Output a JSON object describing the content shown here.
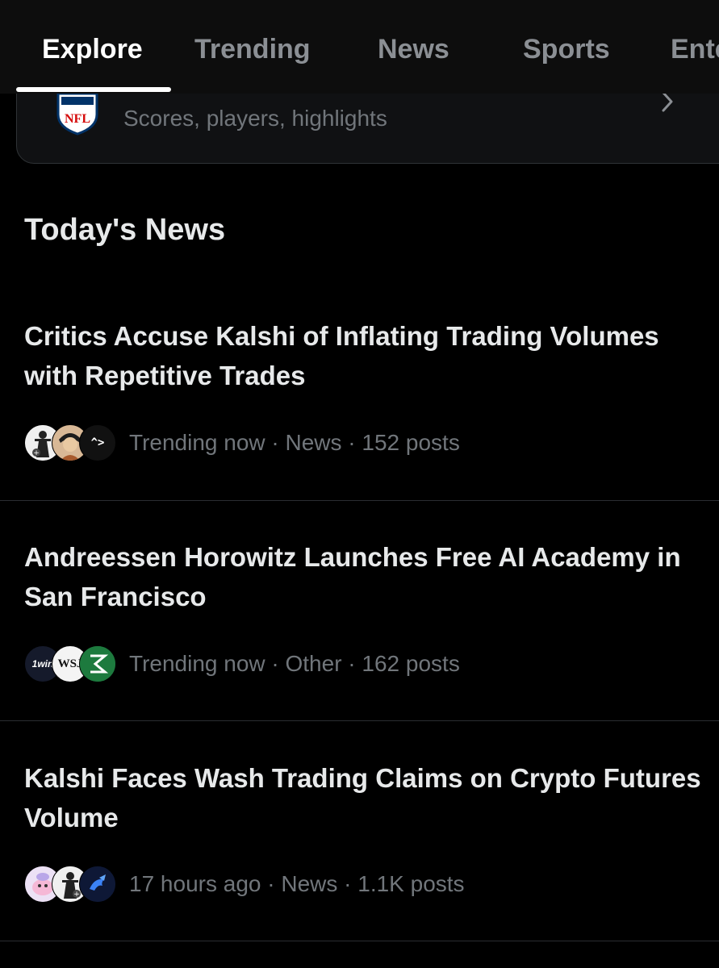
{
  "tabs": [
    {
      "label": "Explore",
      "active": true
    },
    {
      "label": "Trending",
      "active": false
    },
    {
      "label": "News",
      "active": false
    },
    {
      "label": "Sports",
      "active": false
    },
    {
      "label": "Ente",
      "active": false
    }
  ],
  "featured_card": {
    "title": "NFL",
    "subtitle": "Scores, players, highlights",
    "logo_text": "NFL",
    "chevron_icon": "chevron-right-icon"
  },
  "section": {
    "title": "Today's News"
  },
  "news": [
    {
      "headline": "Critics Accuse Kalshi of Inflating Trading Volumes with Repetitive Trades",
      "meta": "Trending now · News · 152 posts",
      "avatars": [
        "statue-avatar",
        "person-avatar",
        "code-avatar"
      ],
      "avatar_texts": [
        "",
        "",
        "^>"
      ]
    },
    {
      "headline": "Andreessen Horowitz Launches Free AI Academy in San Francisco",
      "meta": "Trending now · Other · 162 posts",
      "avatars": [
        "1win-avatar",
        "wsj-avatar",
        "green-logo-avatar"
      ],
      "avatar_texts": [
        "1win",
        "WSJ",
        ""
      ]
    },
    {
      "headline": "Kalshi Faces Wash Trading Claims on Crypto Futures Volume",
      "meta": "17 hours ago · News · 1.1K posts",
      "avatars": [
        "pink-character-avatar",
        "statue-avatar",
        "blue-bird-avatar"
      ],
      "avatar_texts": [
        "",
        "",
        ""
      ]
    }
  ],
  "colors": {
    "background": "#000000",
    "primary_text": "#e7e9ea",
    "secondary_text": "#71767b",
    "divider": "#2a2d31",
    "nfl_blue": "#013369",
    "nfl_red": "#d50a0a"
  }
}
